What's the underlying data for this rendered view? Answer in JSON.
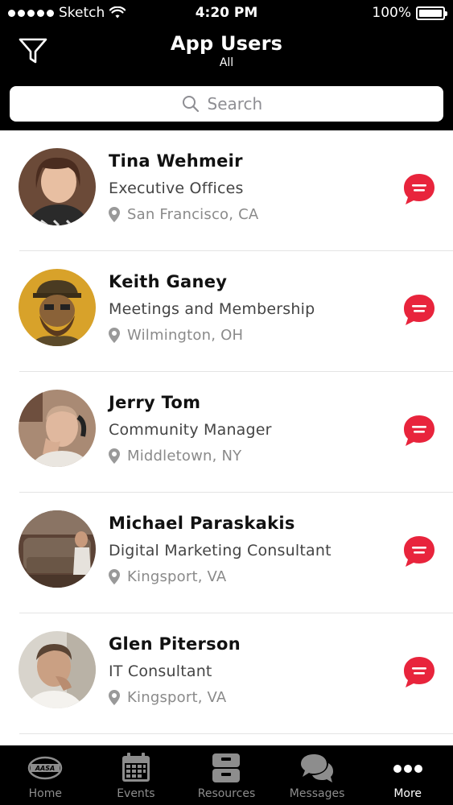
{
  "status_bar": {
    "carrier": "Sketch",
    "time": "4:20 PM",
    "battery": "100%"
  },
  "header": {
    "title": "App Users",
    "subtitle": "All"
  },
  "search": {
    "placeholder": "Search"
  },
  "users": [
    {
      "name": "Tina Wehmeir",
      "role": "Executive Offices",
      "location": "San Francisco, CA"
    },
    {
      "name": "Keith Ganey",
      "role": "Meetings and Membership",
      "location": "Wilmington, OH"
    },
    {
      "name": "Jerry Tom",
      "role": "Community Manager",
      "location": "Middletown, NY"
    },
    {
      "name": "Michael Paraskakis",
      "role": "Digital Marketing Consultant",
      "location": "Kingsport, VA"
    },
    {
      "name": "Glen Piterson",
      "role": "IT Consultant",
      "location": "Kingsport, VA"
    }
  ],
  "tabs": [
    {
      "label": "Home",
      "icon": "logo-icon"
    },
    {
      "label": "Events",
      "icon": "calendar-icon"
    },
    {
      "label": "Resources",
      "icon": "cabinet-icon"
    },
    {
      "label": "Messages",
      "icon": "chat-bubbles-icon"
    },
    {
      "label": "More",
      "icon": "more-dots-icon",
      "active": true
    }
  ],
  "colors": {
    "accent": "#e8243c",
    "header_bg": "#000000",
    "inactive_tab": "#8d8d8d"
  }
}
